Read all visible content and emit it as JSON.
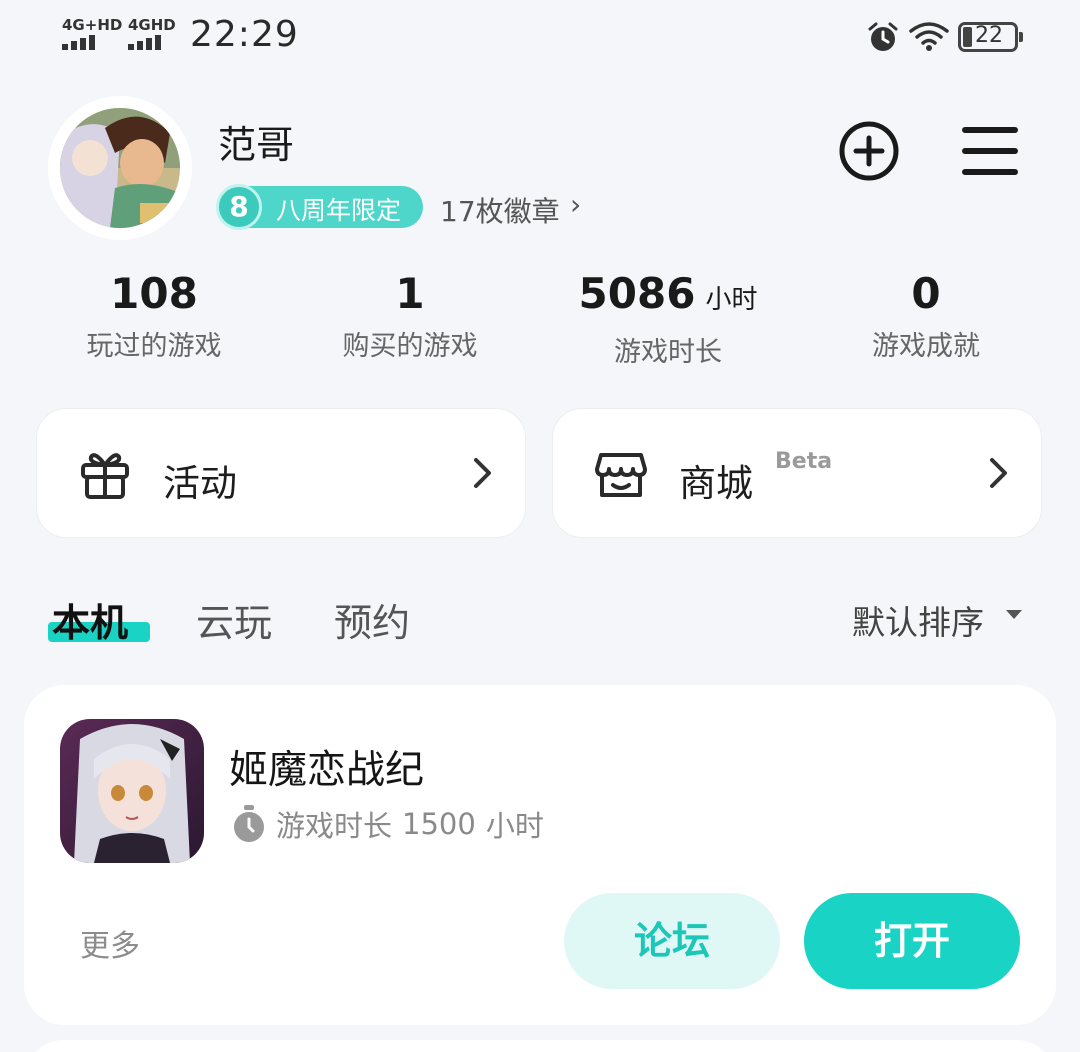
{
  "status_bar": {
    "sim1": "4G+HD",
    "sim2": "4GHD",
    "time": "22:29",
    "battery": "22",
    "icons": [
      "alarm-icon",
      "wifi-icon",
      "battery-icon"
    ]
  },
  "profile": {
    "username": "范哥",
    "badge_label": "八周年限定",
    "badge_coin": "8",
    "badge_count": "17枚徽章",
    "chevron": "›"
  },
  "stats": [
    {
      "value": "108",
      "unit": "",
      "label": "玩过的游戏"
    },
    {
      "value": "1",
      "unit": "",
      "label": "购买的游戏"
    },
    {
      "value": "5086",
      "unit": "小时",
      "label": "游戏时长"
    },
    {
      "value": "0",
      "unit": "",
      "label": "游戏成就"
    }
  ],
  "cards": {
    "activity": {
      "label": "活动",
      "icon": "gift-icon"
    },
    "shop": {
      "label": "商城",
      "tag": "Beta",
      "icon": "store-icon"
    }
  },
  "tabs": [
    {
      "label": "本机",
      "active": true
    },
    {
      "label": "云玩",
      "active": false
    },
    {
      "label": "预约",
      "active": false
    }
  ],
  "sort": {
    "label": "默认排序"
  },
  "game": {
    "name": "姬魔恋战纪",
    "playtime_label": "游戏时长",
    "playtime_value": "1500",
    "playtime_unit": "小时",
    "more": "更多",
    "forum": "论坛",
    "open": "打开"
  },
  "colors": {
    "accent": "#19d3c4",
    "accent_light": "#dff8f6",
    "background": "#f4f6f9"
  }
}
